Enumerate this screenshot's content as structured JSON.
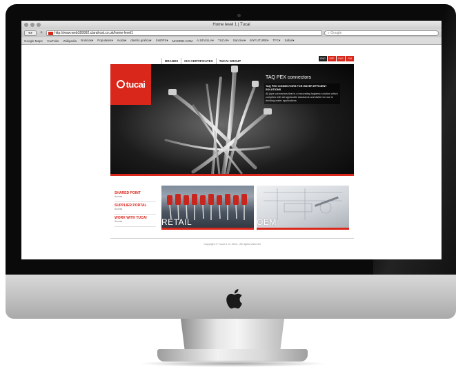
{
  "window": {
    "title": "Home level 1 | Tucai"
  },
  "toolbar": {
    "back_label": "◂ ▸",
    "add_label": "+",
    "url": "http://www.web189992.clarahost.co.uk/home-level1",
    "search_placeholder": "Google"
  },
  "bookmarks": [
    "Google Maps",
    "YouTube",
    "Wikipedia",
    "Noticias▾",
    "Populares▾",
    "moda▾",
    "diseño grafico▾",
    "SHOPS▾",
    "MADRID.COM",
    "A.SEVILLA▾",
    "TUCAI▾",
    "Sanzine▾",
    "MYFUTURE▾",
    "TFC▾",
    "Safari▾"
  ],
  "site": {
    "brand": "tucai",
    "nav": [
      "BRANDS",
      "ISO CERTIFICATES",
      "TUCAI GROUP"
    ],
    "languages": [
      "ENG",
      "ESP",
      "RUS",
      "CHI"
    ],
    "hero": {
      "title": "TAQ PEX connectors",
      "subtitle": "TAQ PEX CONNECTORS FOR WATER EFFICIENT SOLUTIONS",
      "body": "All pipe connectors that is a innovating hygienic solution which complies with all applicable standards worldwide for use in drinking water applications"
    },
    "links": [
      {
        "title": "SHARED POINT",
        "sub": "Access"
      },
      {
        "title": "SUPPLIER PORTAL",
        "sub": "Access"
      },
      {
        "title": "WORK WITH TUCAI",
        "sub": "Access"
      }
    ],
    "tiles": [
      {
        "caption": "RETAIL"
      },
      {
        "caption": "OEM"
      }
    ],
    "copyright": "Copyright © Tucai S. A. 2013 - All rights reserved"
  },
  "colors": {
    "brand_red": "#d9271b",
    "hero_dark": "#111111"
  }
}
